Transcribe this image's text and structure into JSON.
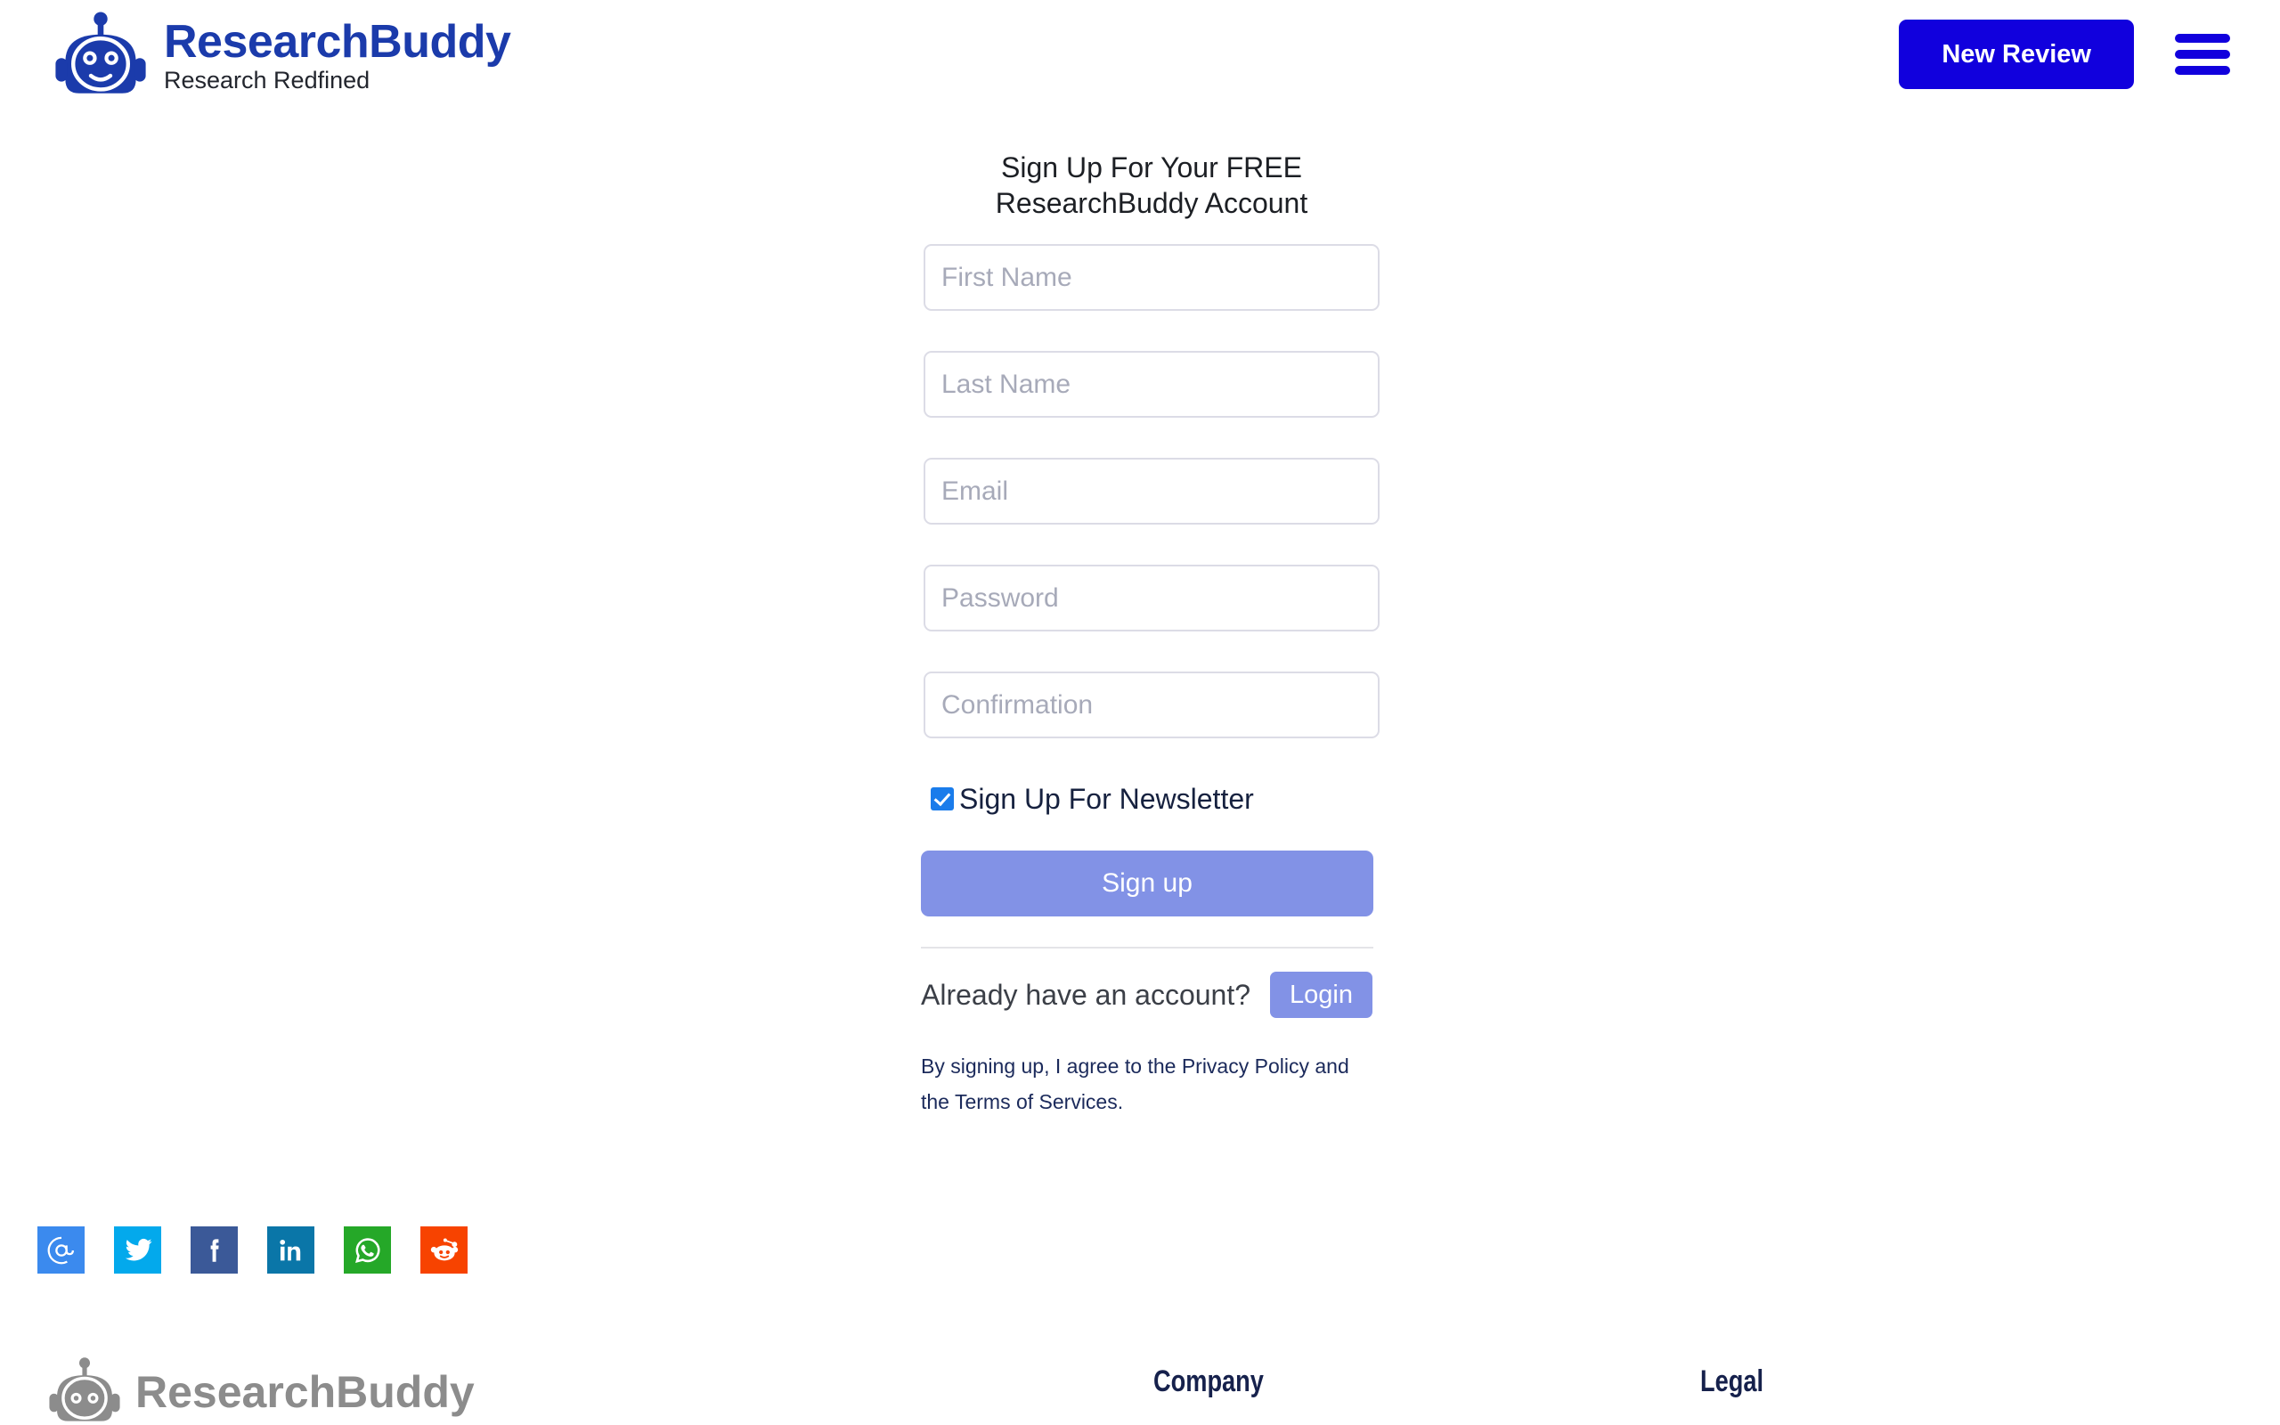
{
  "header": {
    "brand_title": "ResearchBuddy",
    "brand_tagline": "Research Redfined",
    "new_review_label": "New Review",
    "menu_icon": "hamburger-menu-icon",
    "brand_color": "#1b3bab",
    "accent_color": "#1100dd"
  },
  "signup": {
    "heading": "Sign Up For Your FREE\nResearchBuddy Account",
    "fields": [
      {
        "name": "first-name",
        "placeholder": "First Name",
        "value": ""
      },
      {
        "name": "last-name",
        "placeholder": "Last Name",
        "value": ""
      },
      {
        "name": "email",
        "placeholder": "Email",
        "value": ""
      },
      {
        "name": "password",
        "placeholder": "Password",
        "value": ""
      },
      {
        "name": "confirmation",
        "placeholder": "Confirmation",
        "value": ""
      }
    ],
    "newsletter_label": "Sign Up For Newsletter",
    "newsletter_checked": true,
    "submit_label": "Sign up",
    "already_account_text": "Already have an account?",
    "login_label": "Login",
    "terms_prefix": "By signing up, I agree to the ",
    "terms_privacy": "Privacy Policy",
    "terms_middle": " and the ",
    "terms_tos": "Terms of Services",
    "terms_suffix": ".",
    "button_color": "#8292e6",
    "checkbox_color": "#1a7ceb"
  },
  "social": [
    {
      "name": "email-share-button",
      "icon": "at-icon",
      "glyph": "@",
      "color": "#3b8aee"
    },
    {
      "name": "twitter-share-button",
      "icon": "twitter-icon",
      "glyph": "",
      "color": "#03a9ec"
    },
    {
      "name": "facebook-share-button",
      "icon": "facebook-icon",
      "glyph": "f",
      "color": "#3b5998"
    },
    {
      "name": "linkedin-share-button",
      "icon": "linkedin-icon",
      "glyph": "in",
      "color": "#0a76a8"
    },
    {
      "name": "whatsapp-share-button",
      "icon": "whatsapp-icon",
      "glyph": "",
      "color": "#25a828"
    },
    {
      "name": "reddit-share-button",
      "icon": "reddit-icon",
      "glyph": "",
      "color": "#f74300"
    }
  ],
  "footer": {
    "brand_name": "ResearchBuddy",
    "brand_color": "#8c8c8c",
    "company_title": "Company",
    "legal_title": "Legal"
  }
}
